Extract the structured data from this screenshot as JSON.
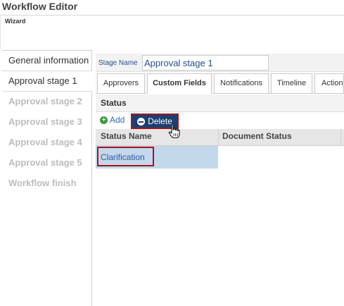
{
  "app": {
    "title": "Workflow Editor",
    "wizard_label": "Wizard"
  },
  "steps": [
    {
      "label": "General information",
      "state": "normal"
    },
    {
      "label": "Approval stage 1",
      "state": "active"
    },
    {
      "label": "Approval stage 2",
      "state": "disabled"
    },
    {
      "label": "Approval stage 3",
      "state": "disabled"
    },
    {
      "label": "Approval stage 4",
      "state": "disabled"
    },
    {
      "label": "Approval stage 5",
      "state": "disabled"
    },
    {
      "label": "Workflow finish",
      "state": "disabled"
    }
  ],
  "stage": {
    "label": "Stage Name",
    "value": "Approval stage 1"
  },
  "tabs": [
    {
      "label": "Approvers",
      "active": false
    },
    {
      "label": "Custom Fields",
      "active": true
    },
    {
      "label": "Notifications",
      "active": false
    },
    {
      "label": "Timeline",
      "active": false
    },
    {
      "label": "Actions",
      "active": false
    }
  ],
  "status": {
    "title": "Status",
    "add_label": "Add",
    "delete_label": "Delete",
    "columns": [
      "Status Name",
      "Document Status"
    ],
    "rows": [
      [
        "Clarification",
        ""
      ]
    ]
  },
  "icons": {
    "add": "plus-circle-icon",
    "delete": "minus-circle-icon",
    "cursor": "hand-pointer-icon"
  },
  "colors": {
    "delete_bg": "#1b3f73",
    "highlight_border": "#a01818",
    "selected_row": "#c4d8ec",
    "add_icon": "#3a9a3a"
  }
}
